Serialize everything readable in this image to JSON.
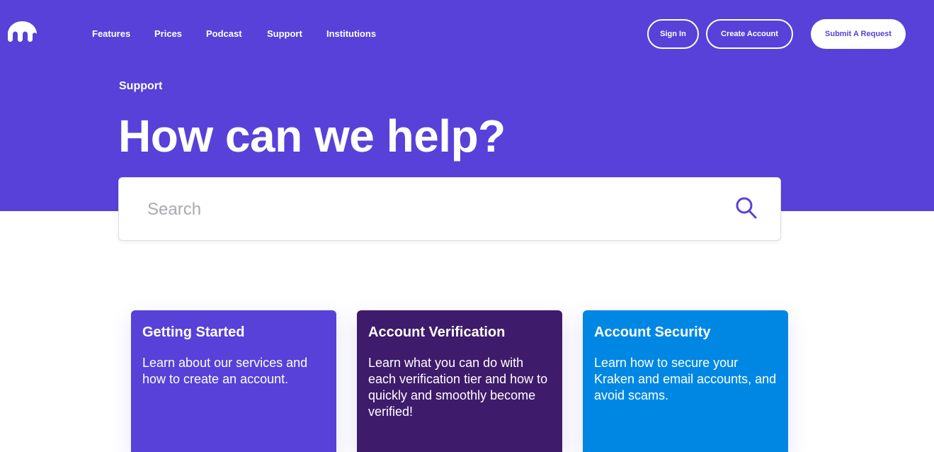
{
  "colors": {
    "brand": "#5741d9",
    "card_1": "#5741d9",
    "card_2": "#3f1b6b",
    "card_3": "#0087e4"
  },
  "header": {
    "logo_icon": "kraken-logo-icon",
    "nav": [
      "Features",
      "Prices",
      "Podcast",
      "Support",
      "Institutions"
    ],
    "sign_in_label": "Sign In",
    "create_account_label": "Create Account",
    "submit_request_label": "Submit A Request"
  },
  "hero": {
    "eyebrow": "Support",
    "title": "How can we help?"
  },
  "search": {
    "placeholder": "Search",
    "icon": "search-icon"
  },
  "cards": [
    {
      "title": "Getting Started",
      "description": "Learn about our services and how to create an account."
    },
    {
      "title": "Account Verification",
      "description": "Learn what you can do with each verification tier and how to quickly and smoothly become verified!"
    },
    {
      "title": "Account Security",
      "description": "Learn how to secure your Kraken and email accounts, and avoid scams."
    }
  ]
}
